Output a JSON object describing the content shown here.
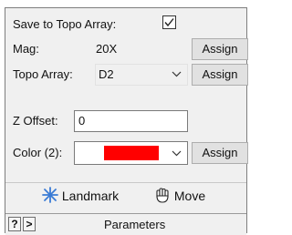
{
  "save_to_topo": {
    "label": "Save to Topo Array:",
    "checked": true
  },
  "mag": {
    "label": "Mag:",
    "value": "20X",
    "assign_label": "Assign"
  },
  "topo_array": {
    "label": "Topo Array:",
    "selected": "D2",
    "assign_label": "Assign"
  },
  "z_offset": {
    "label": "Z Offset:",
    "value": "0"
  },
  "color": {
    "label": "Color (2):",
    "swatch_color": "#ff0000",
    "assign_label": "Assign"
  },
  "actions": {
    "landmark_label": "Landmark",
    "move_label": "Move"
  },
  "footer": {
    "help_label": "?",
    "expand_label": ">",
    "title": "Parameters"
  }
}
